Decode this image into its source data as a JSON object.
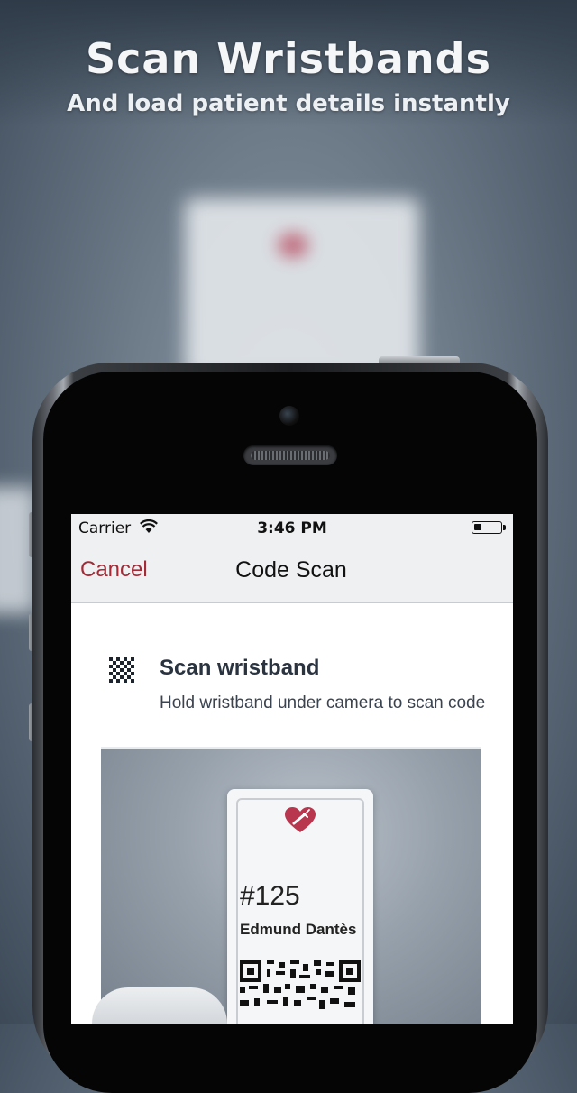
{
  "promo": {
    "headline": "Scan Wristbands",
    "subheadline": "And load patient details instantly"
  },
  "status_bar": {
    "carrier": "Carrier",
    "time": "3:46 PM",
    "icons": [
      "wifi-icon",
      "battery-icon"
    ]
  },
  "navbar": {
    "cancel_label": "Cancel",
    "title": "Code Scan"
  },
  "scan_section": {
    "icon": "qr-code-icon",
    "title": "Scan wristband",
    "description": "Hold wristband under camera to scan code"
  },
  "wristband": {
    "icon": "heart-syringe-icon",
    "patient_number": "#125",
    "patient_name": "Edmund Dantès"
  },
  "colors": {
    "accent": "#a52a36",
    "heart": "#b8374f",
    "navbar_bg": "#eef0f2"
  }
}
